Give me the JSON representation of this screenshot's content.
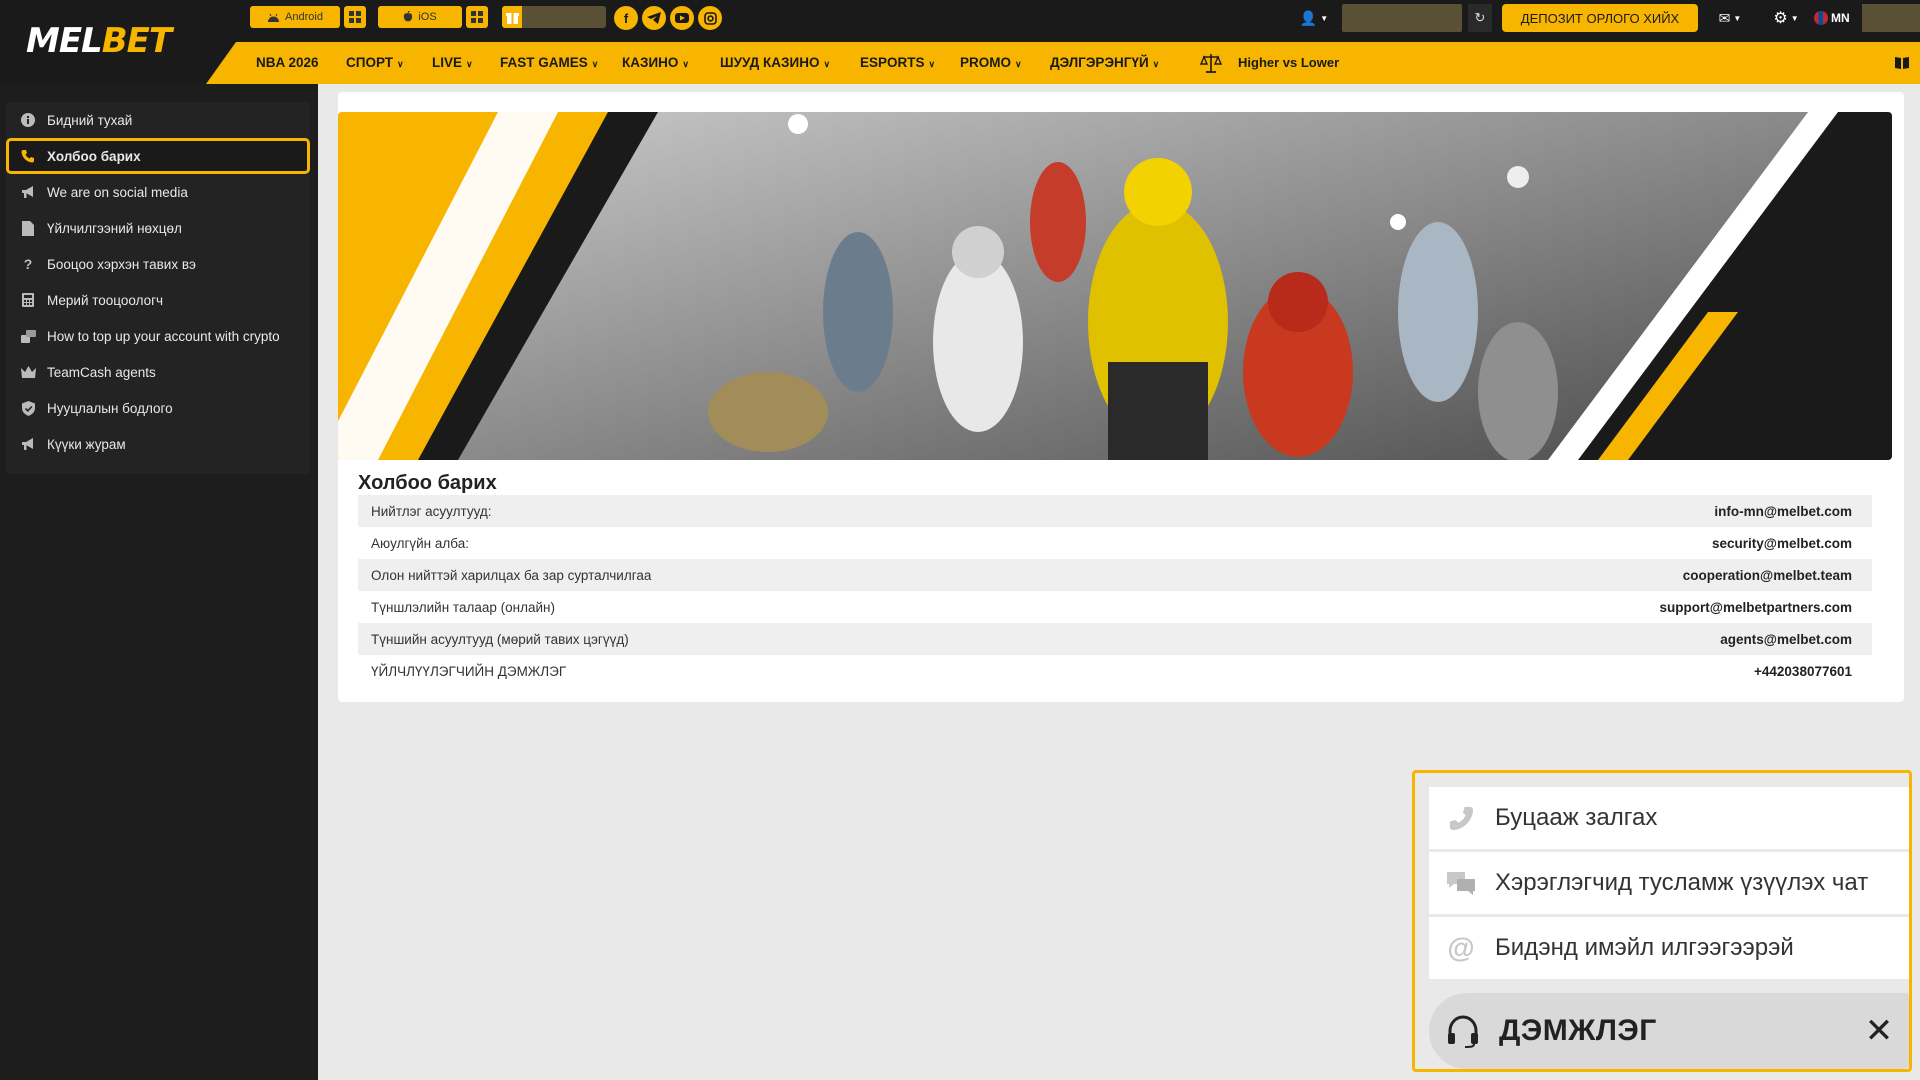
{
  "header": {
    "logo_prefix": "MEL",
    "logo_suffix": "BET",
    "android_label": "Android",
    "ios_label": "iOS",
    "social_icons": [
      "facebook-icon",
      "telegram-icon",
      "youtube-icon",
      "instagram-icon"
    ],
    "deposit_label": "ДЕПОЗИТ ОРЛОГО ХИЙХ",
    "language": "MN"
  },
  "nav": {
    "items": [
      {
        "label": "NBA 2026",
        "dropdown": false
      },
      {
        "label": "СПОРТ",
        "dropdown": true
      },
      {
        "label": "LIVE",
        "dropdown": true
      },
      {
        "label": "FAST GAMES",
        "dropdown": true
      },
      {
        "label": "КАЗИНО",
        "dropdown": true
      },
      {
        "label": "ШУУД КАЗИНО",
        "dropdown": true
      },
      {
        "label": "ESPORTS",
        "dropdown": true
      },
      {
        "label": "PROMO",
        "dropdown": true
      },
      {
        "label": "ДЭЛГЭРЭНГҮЙ",
        "dropdown": true
      }
    ],
    "higher_lower": "Higher vs Lower"
  },
  "sidebar": {
    "items": [
      {
        "label": "Бидний тухай",
        "icon": "info-icon",
        "active": false
      },
      {
        "label": "Холбоо барих",
        "icon": "phone-icon",
        "active": true
      },
      {
        "label": "We are on social media",
        "icon": "megaphone-icon",
        "active": false
      },
      {
        "label": "Үйлчилгээний нөхцөл",
        "icon": "document-icon",
        "active": false
      },
      {
        "label": "Бооцоо хэрхэн тавих вэ",
        "icon": "question-icon",
        "active": false
      },
      {
        "label": "Мерий тооцоологч",
        "icon": "calculator-icon",
        "active": false
      },
      {
        "label": "How to top up your account with crypto",
        "icon": "coins-icon",
        "active": false
      },
      {
        "label": "TeamCash agents",
        "icon": "crown-icon",
        "active": false
      },
      {
        "label": "Нууцлалын бодлого",
        "icon": "shield-icon",
        "active": false
      },
      {
        "label": "Күүки журам",
        "icon": "megaphone-icon",
        "active": false
      }
    ]
  },
  "contact": {
    "title": "Холбоо барих",
    "rows": [
      {
        "label": "Нийтлэг асуултууд:",
        "value": "info-mn@melbet.com"
      },
      {
        "label": "Аюулгүйн алба:",
        "value": "security@melbet.com"
      },
      {
        "label": "Олон нийттэй харилцах ба зар сурталчилгаа",
        "value": "cooperation@melbet.team"
      },
      {
        "label": "Түншлэлийн талаар (онлайн)",
        "value": "support@melbetpartners.com"
      },
      {
        "label": "Түншийн асуултууд (мөрий тавих цэгүүд)",
        "value": "agents@melbet.com"
      },
      {
        "label": "ҮЙЛЧЛҮҮЛЭГЧИЙН ДЭМЖЛЭГ",
        "value": "+442038077601"
      }
    ]
  },
  "support": {
    "options": [
      {
        "label": "Буцааж залгах",
        "icon": "phone-icon"
      },
      {
        "label": "Хэрэглэгчид тусламж үзүүлэх чат",
        "icon": "chat-icon"
      },
      {
        "label": "Бидэнд имэйл илгээгээрэй",
        "icon": "at-icon"
      }
    ],
    "bar_label": "ДЭМЖЛЭГ"
  },
  "colors": {
    "accent": "#f7b500",
    "dark": "#1a1a1a",
    "sidebar": "#232323"
  }
}
